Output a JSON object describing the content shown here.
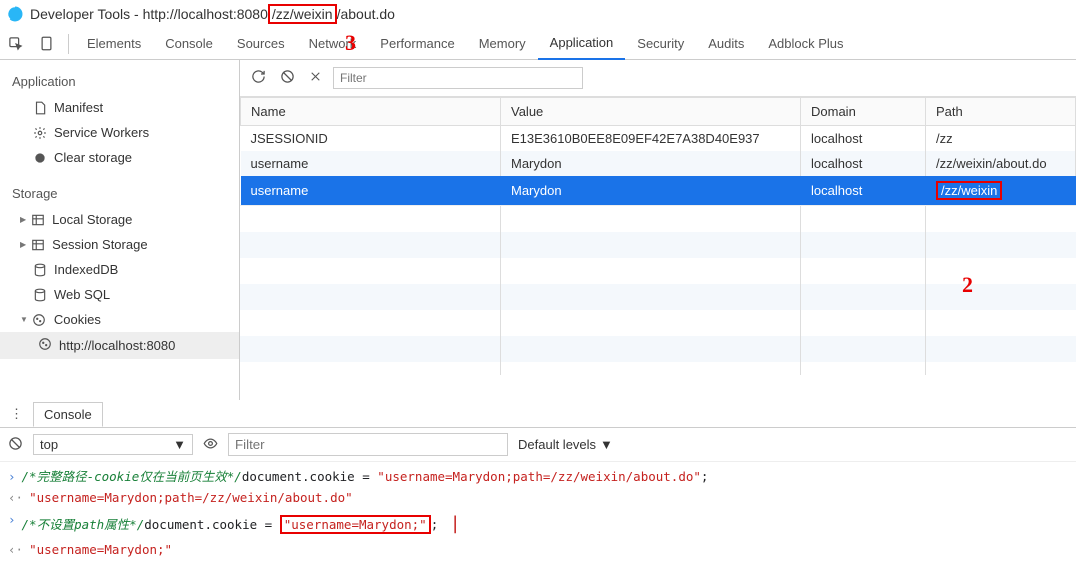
{
  "window": {
    "title_prefix": "Developer Tools - http://localhost:8080",
    "url_path_boxed": "/zz/weixin",
    "url_path_rest": "/about.do"
  },
  "tabs": {
    "elements": "Elements",
    "console": "Console",
    "sources": "Sources",
    "network": "Network",
    "performance": "Performance",
    "memory": "Memory",
    "application": "Application",
    "security": "Security",
    "audits": "Audits",
    "adblock": "Adblock Plus"
  },
  "sidebar": {
    "application": "Application",
    "manifest": "Manifest",
    "service_workers": "Service Workers",
    "clear_storage": "Clear storage",
    "storage": "Storage",
    "local_storage": "Local Storage",
    "session_storage": "Session Storage",
    "indexeddb": "IndexedDB",
    "websql": "Web SQL",
    "cookies": "Cookies",
    "cookie_host": "http://localhost:8080"
  },
  "toolbar": {
    "filter_placeholder": "Filter"
  },
  "table": {
    "headers": {
      "name": "Name",
      "value": "Value",
      "domain": "Domain",
      "path": "Path"
    },
    "rows": [
      {
        "name": "JSESSIONID",
        "value": "E13E3610B0EE8E09EF42E7A38D40E937",
        "domain": "localhost",
        "path": "/zz"
      },
      {
        "name": "username",
        "value": "Marydon",
        "domain": "localhost",
        "path": "/zz/weixin/about.do"
      },
      {
        "name": "username",
        "value": "Marydon",
        "domain": "localhost",
        "path": "/zz/weixin"
      }
    ]
  },
  "drawer": {
    "console_tab": "Console",
    "top": "top",
    "filter_placeholder": "Filter",
    "levels": "Default levels"
  },
  "console": {
    "l1_comment": "/*完整路径-cookie仅在当前页生效*/",
    "l1_code_a": "document.cookie = ",
    "l1_str": "\"username=Marydon;path=/zz/weixin/about.do\"",
    "l1_code_b": ";",
    "l2_out": "\"username=Marydon;path=/zz/weixin/about.do\"",
    "l3_comment": "/*不设置path属性*/",
    "l3_code_a": "document.cookie = ",
    "l3_str": "\"username=Marydon;\"",
    "l3_code_b": ";",
    "l4_out": "\"username=Marydon;\""
  },
  "annotations": {
    "a3": "3",
    "a2": "2"
  }
}
